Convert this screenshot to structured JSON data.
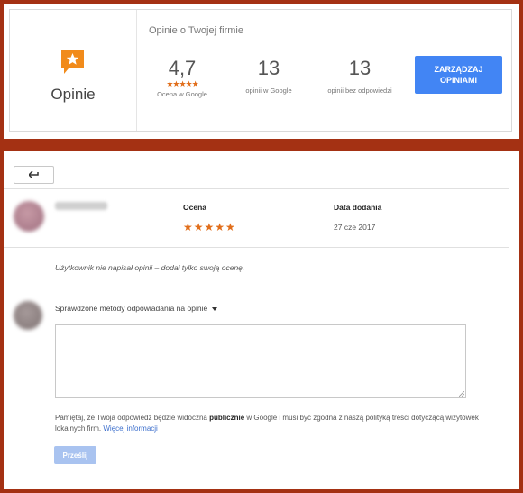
{
  "header": {
    "section_label": "Opinie",
    "summary_title": "Opinie o Twojej firmie",
    "rating": {
      "value": "4,7",
      "stars": "★★★★★",
      "label": "Ocena w Google",
      "star_value": 4.7
    },
    "reviews_count": {
      "value": "13",
      "label": "opinii w Google"
    },
    "unanswered_count": {
      "value": "13",
      "label": "opinii bez odpowiedzi"
    },
    "manage_button": "ZARZĄDZAJ OPINIAMI",
    "accent_color": "#e16e1b",
    "button_color": "#4285f4"
  },
  "review": {
    "back_icon": "back-arrow-icon",
    "rating_header": "Ocena",
    "date_header": "Data dodania",
    "stars": "★★★★★",
    "date": "27 cze 2017",
    "note": "Użytkownik nie napisał opinii – dodał tylko swoją ocenę."
  },
  "reply": {
    "methods_label": "Sprawdzone metody odpowiadania na opinie",
    "textarea_value": "",
    "info_part1": "Pamiętaj, że Twoja odpowiedź będzie widoczna ",
    "info_bold": "publicznie",
    "info_part2": " w Google i musi być zgodna z naszą polityką treści dotyczącą wizytówek lokalnych firm. ",
    "info_link": "Więcej informacji",
    "submit_button": "Prześlij"
  }
}
